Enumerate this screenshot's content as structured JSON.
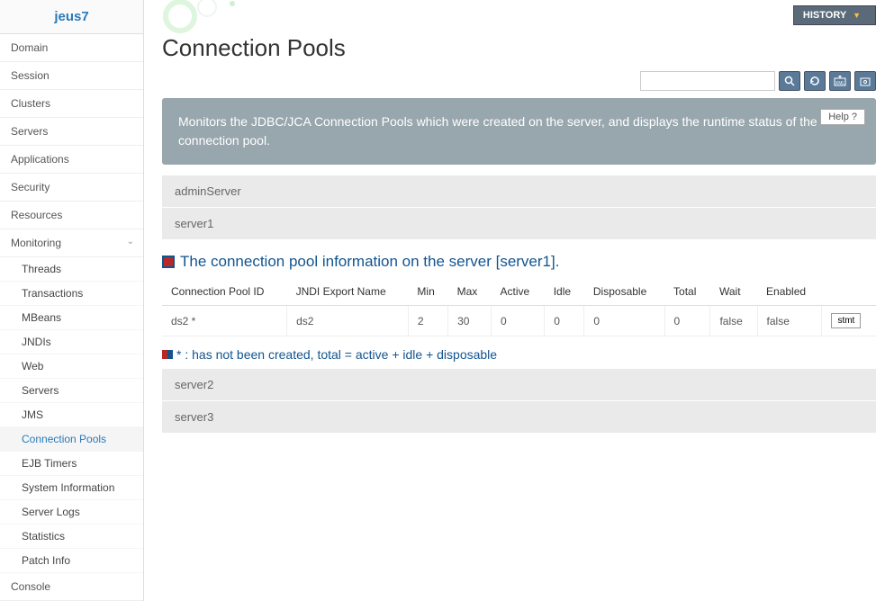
{
  "app_name": "jeus7",
  "nav": {
    "domain": "Domain",
    "session": "Session",
    "clusters": "Clusters",
    "servers": "Servers",
    "applications": "Applications",
    "security": "Security",
    "resources": "Resources",
    "monitoring": "Monitoring",
    "console": "Console"
  },
  "subnav": {
    "threads": "Threads",
    "transactions": "Transactions",
    "mbeans": "MBeans",
    "jndis": "JNDIs",
    "web": "Web",
    "servers": "Servers",
    "jms": "JMS",
    "connection_pools": "Connection Pools",
    "ejb_timers": "EJB Timers",
    "system_information": "System Information",
    "server_logs": "Server Logs",
    "statistics": "Statistics",
    "patch_info": "Patch Info"
  },
  "header": {
    "history": "HISTORY",
    "page_title": "Connection Pools",
    "search_placeholder": ""
  },
  "banner": {
    "text": "Monitors the JDBC/JCA Connection Pools which were created on the server, and displays the runtime status of the connection pool.",
    "help": "Help  ?"
  },
  "servers": {
    "admin": "adminServer",
    "s1": "server1",
    "s2": "server2",
    "s3": "server3"
  },
  "section_title": "The connection pool information on the server [server1].",
  "table": {
    "headers": {
      "id": "Connection Pool ID",
      "jndi": "JNDI Export Name",
      "min": "Min",
      "max": "Max",
      "active": "Active",
      "idle": "Idle",
      "disposable": "Disposable",
      "total": "Total",
      "wait": "Wait",
      "enabled": "Enabled",
      "blank": ""
    },
    "row": {
      "id": "ds2 *",
      "jndi": "ds2",
      "min": "2",
      "max": "30",
      "active": "0",
      "idle": "0",
      "disposable": "0",
      "total": "0",
      "wait": "false",
      "enabled": "false",
      "stmt": "stmt"
    }
  },
  "legend": "* : has not been created, total = active + idle + disposable"
}
